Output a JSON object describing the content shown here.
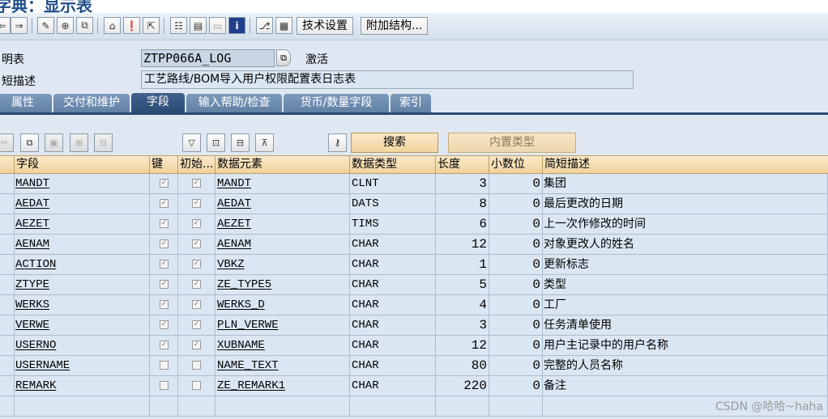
{
  "header": {
    "title": "字典：显示表",
    "table_label": "明表",
    "table_name": "ZTPP066A_LOG",
    "status": "激活",
    "short_desc_label": "短描述",
    "short_desc": "工艺路线/BOM导入用户权限配置表日志表"
  },
  "toolbar": {
    "tech_settings": "技术设置",
    "append_structure": "附加结构..."
  },
  "tabs": [
    "属性",
    "交付和维护",
    "字段",
    "输入帮助/检查",
    "货币/数量字段",
    "索引"
  ],
  "active_tab": "字段",
  "grid_toolbar": {
    "search": "搜索",
    "builtin_type": "内置类型"
  },
  "grid": {
    "columns": [
      "字段",
      "键",
      "初始...",
      "数据元素",
      "数据类型",
      "长度",
      "小数位",
      "简短描述"
    ],
    "rows": [
      {
        "field": "MANDT",
        "key": true,
        "initial": true,
        "element": "MANDT",
        "type": "CLNT",
        "length": "3",
        "decimals": "0",
        "desc": "集团"
      },
      {
        "field": "AEDAT",
        "key": true,
        "initial": true,
        "element": "AEDAT",
        "type": "DATS",
        "length": "8",
        "decimals": "0",
        "desc": "最后更改的日期"
      },
      {
        "field": "AEZET",
        "key": true,
        "initial": true,
        "element": "AEZET",
        "type": "TIMS",
        "length": "6",
        "decimals": "0",
        "desc": "上一次作修改的时间"
      },
      {
        "field": "AENAM",
        "key": true,
        "initial": true,
        "element": "AENAM",
        "type": "CHAR",
        "length": "12",
        "decimals": "0",
        "desc": "对象更改人的姓名"
      },
      {
        "field": "ACTION",
        "key": true,
        "initial": true,
        "element": "VBKZ",
        "type": "CHAR",
        "length": "1",
        "decimals": "0",
        "desc": "更新标志"
      },
      {
        "field": "ZTYPE",
        "key": true,
        "initial": true,
        "element": "ZE_TYPE5",
        "type": "CHAR",
        "length": "5",
        "decimals": "0",
        "desc": "类型"
      },
      {
        "field": "WERKS",
        "key": true,
        "initial": true,
        "element": "WERKS_D",
        "type": "CHAR",
        "length": "4",
        "decimals": "0",
        "desc": "工厂"
      },
      {
        "field": "VERWE",
        "key": true,
        "initial": true,
        "element": "PLN_VERWE",
        "type": "CHAR",
        "length": "3",
        "decimals": "0",
        "desc": "任务清单使用"
      },
      {
        "field": "USERNO",
        "key": true,
        "initial": true,
        "element": "XUBNAME",
        "type": "CHAR",
        "length": "12",
        "decimals": "0",
        "desc": "用户主记录中的用户名称"
      },
      {
        "field": "USERNAME",
        "key": false,
        "initial": false,
        "element": "NAME_TEXT",
        "type": "CHAR",
        "length": "80",
        "decimals": "0",
        "desc": "完整的人员名称"
      },
      {
        "field": "REMARK",
        "key": false,
        "initial": false,
        "element": "ZE_REMARK1",
        "type": "CHAR",
        "length": "220",
        "decimals": "0",
        "desc": "备注"
      }
    ]
  },
  "watermark": "CSDN @哈哈~haha",
  "colors": {
    "tab": "#6d8cb0",
    "tab_active": "#2a4a74",
    "grid_header": "#f5dca9",
    "grid_bg": "#dbe6f3",
    "link": "#1a1a80"
  }
}
